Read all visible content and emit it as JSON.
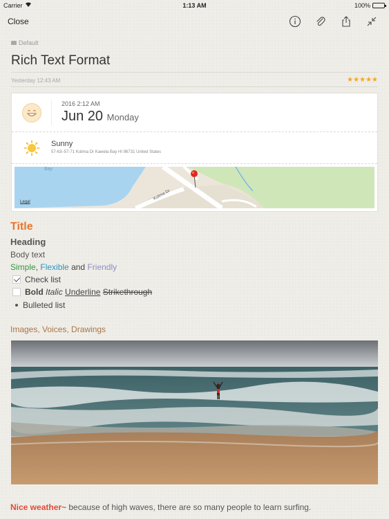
{
  "status_bar": {
    "carrier": "Carrier",
    "time": "1:13 AM",
    "battery": "100%"
  },
  "nav": {
    "close_label": "Close",
    "icons": [
      "info-icon",
      "attachment-icon",
      "share-icon",
      "collapse-icon"
    ]
  },
  "note": {
    "folder": "Default",
    "title": "Rich Text Format",
    "created": "Yesterday 12:43 AM",
    "rating": "★★★★★",
    "rating_value": 5
  },
  "card": {
    "mood": "smile-icon",
    "year_time": "2016  2:12 AM",
    "date": "Jun 20",
    "weekday": "Monday",
    "weather": "Sunny",
    "address": "57-63–57-71 Kulima Dr Kawela Bay HI 96731 United States",
    "map": {
      "bay_label": "Bay",
      "road_label": "Kulima Dr",
      "legal": "Legal"
    }
  },
  "rich_text": {
    "title": "Title",
    "heading": "Heading",
    "body": "Body text",
    "style_line": {
      "simple": "Simple",
      "comma": ",",
      "flexible": "Flexible",
      "and": "and",
      "friendly": "Friendly"
    },
    "check_list": "Check list",
    "formats": {
      "bold": "Bold",
      "italic": "Italic",
      "underline": "Underline",
      "strike": "Strikethrough"
    },
    "bulleted": "Bulleted list",
    "media": "Images, Voices, Drawings"
  },
  "footer": {
    "highlight": "Nice weather~",
    "text": " because of high waves, there are so many people to learn surfing."
  },
  "colors": {
    "accent_orange": "#e8762f",
    "star": "#f4a623",
    "simple_green": "#2e9a3d",
    "flexible_blue": "#2495c0",
    "friendly_purple": "#8a8ec7",
    "media_brown": "#a9744a",
    "nice_weather_red": "#e04a3b"
  }
}
